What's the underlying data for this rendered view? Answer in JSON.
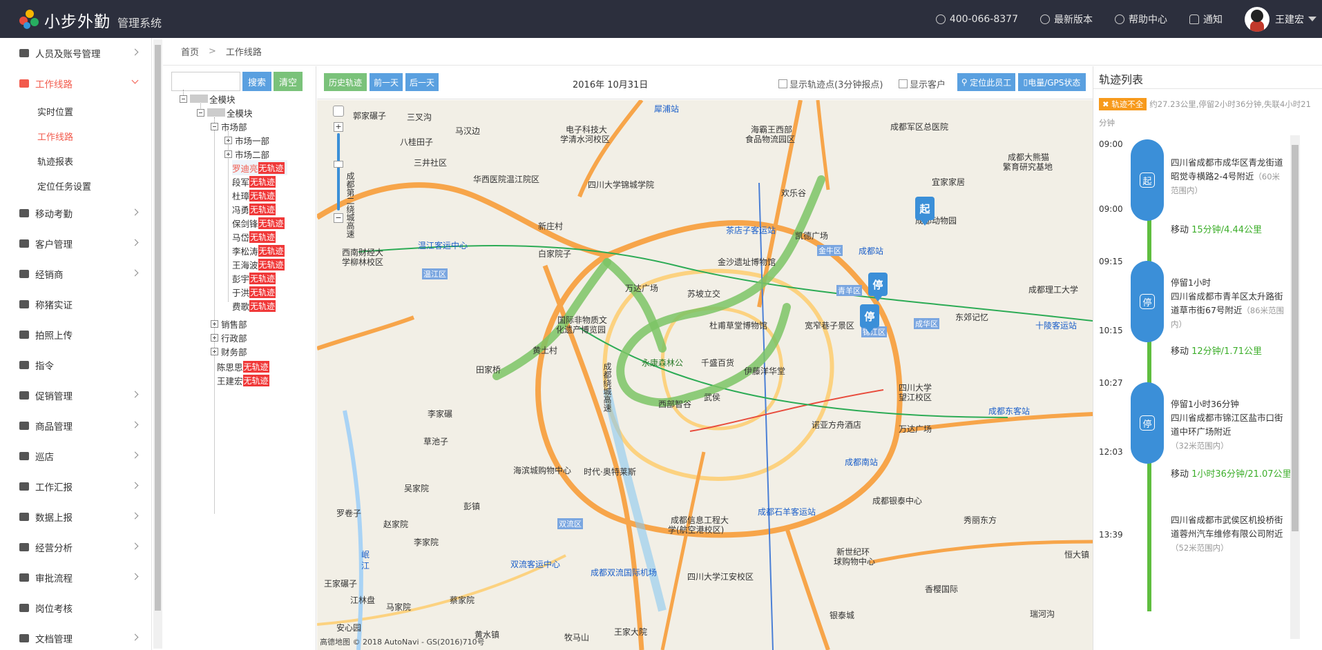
{
  "header": {
    "brand": "小步外勤",
    "subtitle": "管理系统",
    "phone": "400-066-8377",
    "latest_version": "最新版本",
    "help_center": "帮助中心",
    "notify": "通知",
    "user_name": "王建宏",
    "colors": {
      "bg": "#2c2f3d",
      "accent": "#f25a4c"
    }
  },
  "sidebar": {
    "items": [
      {
        "label": "人员及账号管理",
        "icon": "sitemap-icon"
      },
      {
        "label": "工作线路",
        "icon": "pin-icon",
        "active": true
      },
      {
        "label": "移动考勤",
        "icon": "calendar-icon"
      },
      {
        "label": "客户管理",
        "icon": "user-icon"
      },
      {
        "label": "经销商",
        "icon": "dealer-icon"
      },
      {
        "label": "称猪实证",
        "icon": "scale-icon"
      },
      {
        "label": "拍照上传",
        "icon": "camera-icon"
      },
      {
        "label": "指令",
        "icon": "list-icon"
      },
      {
        "label": "促销管理",
        "icon": "promo-icon"
      },
      {
        "label": "商品管理",
        "icon": "box-icon"
      },
      {
        "label": "巡店",
        "icon": "store-icon"
      },
      {
        "label": "工作汇报",
        "icon": "report-icon"
      },
      {
        "label": "数据上报",
        "icon": "upload-icon"
      },
      {
        "label": "经营分析",
        "icon": "pie-icon"
      },
      {
        "label": "审批流程",
        "icon": "table-icon"
      },
      {
        "label": "岗位考核",
        "icon": "chart-icon"
      },
      {
        "label": "文档管理",
        "icon": "doc-icon"
      }
    ],
    "sub_items": [
      "实时位置",
      "工作线路",
      "轨迹报表",
      "定位任务设置"
    ]
  },
  "breadcrumb": {
    "home": "首页",
    "sep": ">",
    "current": "工作线路"
  },
  "tree": {
    "search_placeholder": "",
    "search_btn": "搜索",
    "clear_btn": "清空",
    "root": "全模块",
    "level1": "全模块",
    "dept_market": "市场部",
    "market1": "市场一部",
    "market2": "市场二部",
    "no_track": "无轨迹",
    "people": [
      "罗迪亮",
      "段军",
      "杜璋",
      "冯勇",
      "保剑锋",
      "马岱",
      "李松涛",
      "王海波",
      "彭宇",
      "于洪",
      "费歌"
    ],
    "dept_sales": "销售部",
    "dept_admin": "行政部",
    "dept_finance": "财务部",
    "person_chen": "陈思思",
    "person_wang": "王建宏"
  },
  "toolbar": {
    "history": "历史轨迹",
    "prev_day": "前一天",
    "next_day": "后一天",
    "date": "2016年 10月31日",
    "show_points": "显示轨迹点(3分钟报点)",
    "show_customers": "显示客户",
    "locate_staff": "定位此员工",
    "battery_gps": "电量/GPS状态"
  },
  "map": {
    "labels": [
      {
        "t": "郭家碾子",
        "c": ""
      },
      {
        "t": "三叉沟",
        "c": ""
      },
      {
        "t": "马汉边",
        "c": ""
      },
      {
        "t": "八桂田子",
        "c": ""
      },
      {
        "t": "三井社区",
        "c": ""
      },
      {
        "t": "电子科技大",
        "c": ""
      },
      {
        "t": "学清水河校区",
        "c": ""
      },
      {
        "t": "犀浦站",
        "c": "blue"
      },
      {
        "t": "海霸王西部",
        "c": ""
      },
      {
        "t": "食品物流园区",
        "c": ""
      },
      {
        "t": "成都军区总医院",
        "c": ""
      },
      {
        "t": "成都大熊猫",
        "c": ""
      },
      {
        "t": "繁育研究基地",
        "c": ""
      },
      {
        "t": "华西医院温江院区",
        "c": ""
      },
      {
        "t": "四川大学锦城学院",
        "c": ""
      },
      {
        "t": "欢乐谷",
        "c": ""
      },
      {
        "t": "宜家家居",
        "c": ""
      },
      {
        "t": "成都动物园",
        "c": ""
      },
      {
        "t": "茶店子客运站",
        "c": "blue"
      },
      {
        "t": "凯德广场",
        "c": ""
      },
      {
        "t": "成都站",
        "c": "blue"
      },
      {
        "t": "金牛区",
        "c": "tag"
      },
      {
        "t": "温江客运中心",
        "c": "blue"
      },
      {
        "t": "西南财经大",
        "c": ""
      },
      {
        "t": "学柳林校区",
        "c": ""
      },
      {
        "t": "温江区",
        "c": "tag"
      },
      {
        "t": "金沙遗址博物馆",
        "c": ""
      },
      {
        "t": "万达广场",
        "c": ""
      },
      {
        "t": "苏坡立交",
        "c": ""
      },
      {
        "t": "青羊区",
        "c": "tag"
      },
      {
        "t": "成都理工大学",
        "c": ""
      },
      {
        "t": "国际非物质文",
        "c": ""
      },
      {
        "t": "化遗产博览园",
        "c": ""
      },
      {
        "t": "杜甫草堂博物馆",
        "c": ""
      },
      {
        "t": "宽窄巷子景区",
        "c": ""
      },
      {
        "t": "成华区",
        "c": "tag"
      },
      {
        "t": "东郊记忆",
        "c": ""
      },
      {
        "t": "十陵客运站",
        "c": "blue"
      },
      {
        "t": "黄土村",
        "c": ""
      },
      {
        "t": "永康森林公",
        "c": "green"
      },
      {
        "t": "千盛百货",
        "c": ""
      },
      {
        "t": "伊藤洋华堂",
        "c": ""
      },
      {
        "t": "锦江区",
        "c": "tag"
      },
      {
        "t": "四川大学",
        "c": ""
      },
      {
        "t": "望江校区",
        "c": ""
      },
      {
        "t": "成都东客站",
        "c": "blue"
      },
      {
        "t": "田家桥",
        "c": ""
      },
      {
        "t": "西部智谷",
        "c": ""
      },
      {
        "t": "武侯",
        "c": ""
      },
      {
        "t": "诺亚方舟酒店",
        "c": ""
      },
      {
        "t": "万达广场",
        "c": ""
      },
      {
        "t": "李家碾",
        "c": ""
      },
      {
        "t": "草池子",
        "c": ""
      },
      {
        "t": "成都南站",
        "c": "blue"
      },
      {
        "t": "海滨城购物中心",
        "c": ""
      },
      {
        "t": "时代·奥特莱斯",
        "c": ""
      },
      {
        "t": "吴家院",
        "c": ""
      },
      {
        "t": "彭镇",
        "c": ""
      },
      {
        "t": "成都银泰中心",
        "c": ""
      },
      {
        "t": "罗卷子",
        "c": ""
      },
      {
        "t": "赵家院",
        "c": ""
      },
      {
        "t": "双流区",
        "c": "tag"
      },
      {
        "t": "成都信息工程大",
        "c": ""
      },
      {
        "t": "学(航空港校区)",
        "c": ""
      },
      {
        "t": "成都石羊客运站",
        "c": "blue"
      },
      {
        "t": "秀丽东方",
        "c": ""
      },
      {
        "t": "岷",
        "c": "blue"
      },
      {
        "t": "江",
        "c": "blue"
      },
      {
        "t": "李家院",
        "c": ""
      },
      {
        "t": "双流客运中心",
        "c": "blue"
      },
      {
        "t": "成都双流国际机场",
        "c": "blue"
      },
      {
        "t": "新世纪环",
        "c": ""
      },
      {
        "t": "球购物中心",
        "c": ""
      },
      {
        "t": "四川大学江安校区",
        "c": ""
      },
      {
        "t": "恒大镇",
        "c": ""
      },
      {
        "t": "王家碾子",
        "c": ""
      },
      {
        "t": "江林盘",
        "c": ""
      },
      {
        "t": "香樱国际",
        "c": ""
      },
      {
        "t": "银泰城",
        "c": ""
      },
      {
        "t": "黄水镇",
        "c": ""
      },
      {
        "t": "安心园",
        "c": ""
      },
      {
        "t": "王家大院",
        "c": ""
      },
      {
        "t": "牧马山",
        "c": ""
      },
      {
        "t": "瑞河沟",
        "c": ""
      },
      {
        "t": "马家院",
        "c": ""
      },
      {
        "t": "蔡家院",
        "c": ""
      },
      {
        "t": "新庄村",
        "c": ""
      },
      {
        "t": "白家院子",
        "c": ""
      },
      {
        "t": "成都绕城高速",
        "c": ""
      },
      {
        "t": "成都第二绕城高速",
        "c": ""
      }
    ],
    "pins": {
      "start": "起",
      "stop": "停"
    },
    "copyright": "高德地图 © 2018 AutoNavi - GS(2016)710号"
  },
  "track": {
    "title": "轨迹列表",
    "warn_badge": "轨迹不全",
    "summary": "约27.23公里,停留2小时36分钟,失联4小时21分钟",
    "times": [
      "09:00",
      "09:00",
      "09:15",
      "10:15",
      "10:27",
      "12:03",
      "13:39"
    ],
    "entries": [
      {
        "type": "start",
        "icon": "起",
        "title": "",
        "addr": "四川省成都市成华区青龙街道昭觉寺横路2-4号附近",
        "range": "（60米范围内）"
      },
      {
        "type": "move",
        "prefix": "移动 ",
        "value": "15分钟/4.44公里"
      },
      {
        "type": "stop",
        "icon": "停",
        "title": "停留1小时",
        "addr": "四川省成都市青羊区太升路街道草市街67号附近",
        "range": "（86米范围内）"
      },
      {
        "type": "move",
        "prefix": "移动 ",
        "value": "12分钟/1.71公里"
      },
      {
        "type": "stop",
        "icon": "停",
        "title": "停留1小时36分钟",
        "addr": "四川省成都市锦江区盐市口街道中环广场附近",
        "range": "（32米范围内）"
      },
      {
        "type": "move",
        "prefix": "移动 ",
        "value": "1小时36分钟/21.07公里"
      },
      {
        "type": "end",
        "icon": "",
        "title": "",
        "addr": "四川省成都市武侯区机投桥街道蓉州汽车维修有限公司附近",
        "range": "（52米范围内）"
      }
    ]
  }
}
